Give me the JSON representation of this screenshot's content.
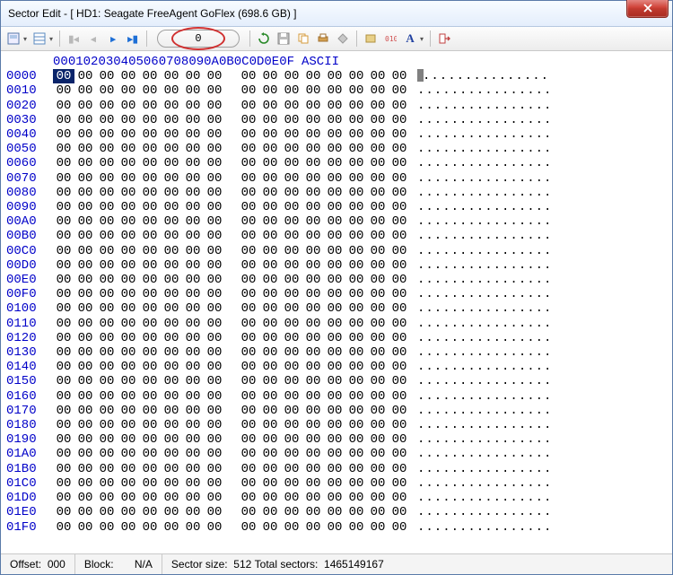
{
  "window": {
    "title": "Sector Edit - [ HD1: Seagate FreeAgent GoFlex (698.6 GB) ]"
  },
  "toolbar": {
    "sector_number": "0"
  },
  "hex": {
    "column_headers": [
      "00",
      "01",
      "02",
      "03",
      "04",
      "05",
      "06",
      "07",
      "08",
      "09",
      "0A",
      "0B",
      "0C",
      "0D",
      "0E",
      "0F"
    ],
    "ascii_header": "ASCII",
    "row_offsets": [
      "0000",
      "0010",
      "0020",
      "0030",
      "0040",
      "0050",
      "0060",
      "0070",
      "0080",
      "0090",
      "00A0",
      "00B0",
      "00C0",
      "00D0",
      "00E0",
      "00F0",
      "0100",
      "0110",
      "0120",
      "0130",
      "0140",
      "0150",
      "0160",
      "0170",
      "0180",
      "0190",
      "01A0",
      "01B0",
      "01C0",
      "01D0",
      "01E0",
      "01F0"
    ],
    "byte_value": "00",
    "ascii_value": "................"
  },
  "status": {
    "offset_label": "Offset:",
    "offset_value": "000",
    "block_label": "Block:",
    "block_value": "N/A",
    "sector_size_label": "Sector size:",
    "sector_size_value": "512",
    "total_sectors_label": "Total sectors:",
    "total_sectors_value": "1465149167"
  }
}
